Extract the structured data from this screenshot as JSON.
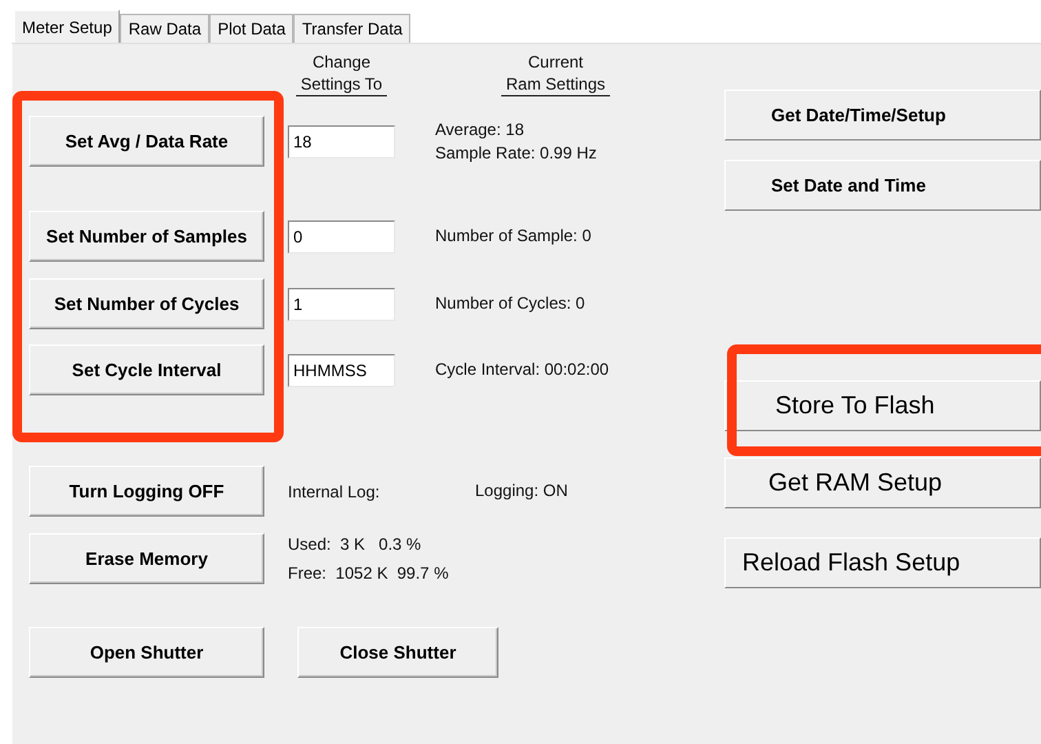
{
  "tabs": [
    {
      "label": "Meter Setup",
      "selected": true
    },
    {
      "label": "Raw Data",
      "selected": false
    },
    {
      "label": "Plot Data",
      "selected": false
    },
    {
      "label": "Transfer Data",
      "selected": false
    }
  ],
  "column_headers": [
    {
      "lines": [
        "Change",
        "Settings To"
      ]
    },
    {
      "lines": [
        "Current",
        "Ram Settings"
      ]
    }
  ],
  "rows": [
    {
      "kind": "input",
      "button": "Set Avg / Data Rate",
      "value": "18",
      "status": [
        "Average: 18",
        "Sample Rate: 0.99 Hz"
      ]
    },
    {
      "kind": "input",
      "button": "Set Number of Samples",
      "value": "0",
      "status": [
        "Number of Sample: 0"
      ]
    },
    {
      "kind": "input",
      "button": "Set Number of Cycles",
      "value": "1",
      "status": [
        "Number of Cycles: 0"
      ]
    },
    {
      "kind": "input",
      "button": "Set Cycle Interval",
      "value": "HHMMSS",
      "status": [
        "Cycle Interval: 00:02:00"
      ]
    },
    {
      "kind": "label",
      "button": "Turn Logging OFF",
      "label": "Internal Log:",
      "status": [
        "Logging: ON"
      ]
    },
    {
      "kind": "info",
      "button": "Erase Memory",
      "status": [
        "Used:  3 K   0.3 %",
        "Free:  1052 K  99.7 %"
      ]
    }
  ],
  "bottom_buttons": [
    "Open Shutter",
    "Close Shutter"
  ],
  "right_buttons": [
    {
      "label": "Get Date/Time/Setup",
      "kind": "bold"
    },
    {
      "label": "Set Date and Time",
      "kind": "bold"
    },
    {
      "label": "Store To Flash",
      "kind": "large"
    },
    {
      "label": "Get RAM Setup",
      "kind": "large"
    },
    {
      "label": "Reload Flash Setup",
      "kind": "large"
    }
  ],
  "annotations": [
    {
      "color": "#ff3a12"
    },
    {
      "color": "#ff3a12"
    }
  ]
}
